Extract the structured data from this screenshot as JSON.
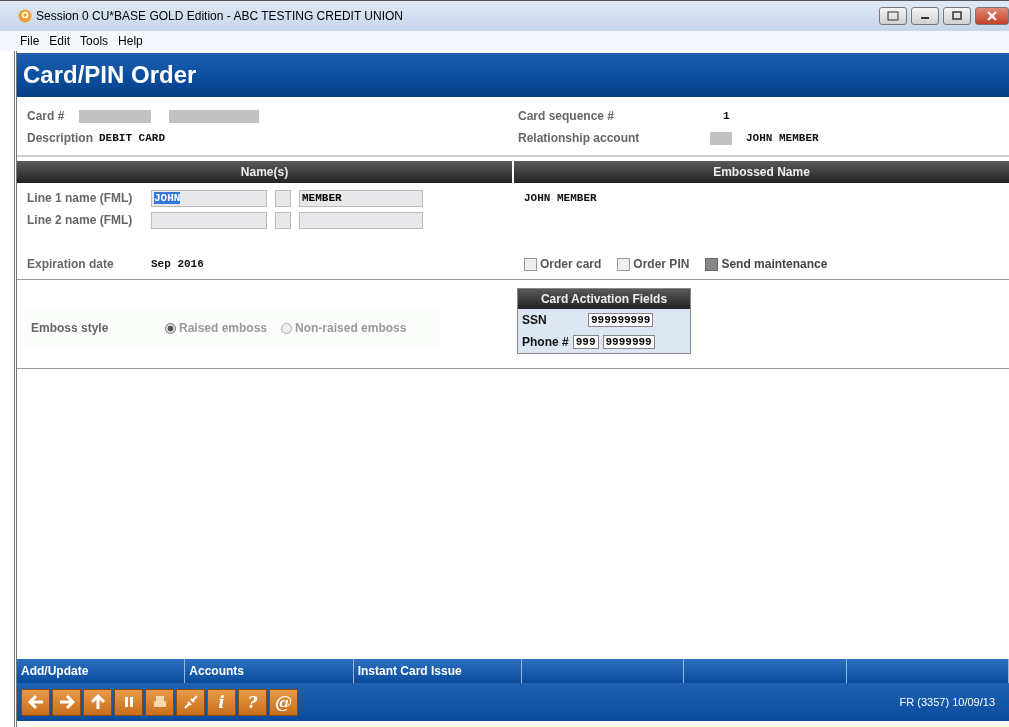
{
  "window": {
    "title": "Session 0 CU*BASE GOLD Edition - ABC TESTING CREDIT UNION"
  },
  "menu": [
    "File",
    "Edit",
    "Tools",
    "Help"
  ],
  "header": {
    "title": "Card/PIN Order"
  },
  "card": {
    "card_label": "Card #",
    "description_label": "Description",
    "description": "DEBIT CARD",
    "sequence_label": "Card sequence #",
    "sequence": "1",
    "relationship_label": "Relationship account",
    "relationship_name": "JOHN MEMBER"
  },
  "names_heading": "Name(s)",
  "embossed_heading": "Embossed Name",
  "name_lines": [
    {
      "label": "Line 1 name (FML)",
      "first": "JOHN",
      "last": "MEMBER",
      "first_selected": true
    },
    {
      "label": "Line 2 name (FML)",
      "first_selected": false
    }
  ],
  "embossed_name": "JOHN MEMBER",
  "expiration": {
    "label": "Expiration date",
    "value": "Sep 2016"
  },
  "options": [
    {
      "label": "Order card",
      "checked": false,
      "disabled": false
    },
    {
      "label": "Order PIN",
      "checked": false,
      "disabled": false
    },
    {
      "label": "Send maintenance",
      "checked": false,
      "disabled": true
    }
  ],
  "emboss_style": {
    "label": "Emboss style",
    "choices": [
      {
        "label": "Raised emboss",
        "selected": true
      },
      {
        "label": "Non-raised emboss",
        "selected": false
      }
    ]
  },
  "activation": {
    "title": "Card Activation Fields",
    "ssn_label": "SSN",
    "ssn": "999999999",
    "phone_label": "Phone #",
    "area": "999",
    "phone": "9999999"
  },
  "function_keys": [
    "Add/Update",
    "Accounts",
    "Instant Card Issue"
  ],
  "toolbar": [
    {
      "kind": "back"
    },
    {
      "kind": "forward"
    },
    {
      "kind": "up"
    },
    {
      "kind": "pause"
    },
    {
      "kind": "print"
    },
    {
      "kind": "link"
    },
    {
      "kind": "glyph",
      "glyph": "i"
    },
    {
      "kind": "glyph",
      "glyph": "?"
    },
    {
      "kind": "glyph",
      "glyph": "@"
    }
  ],
  "status": "FR (3357) 10/09/13"
}
